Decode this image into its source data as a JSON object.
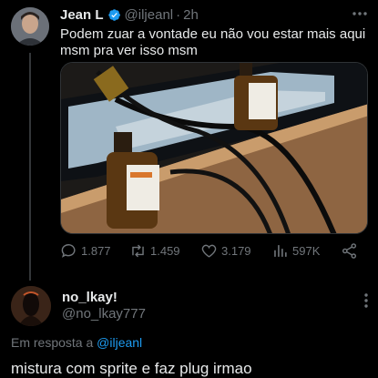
{
  "tweet": {
    "author_name": "Jean L",
    "author_handle": "@iljeanl",
    "separator": "·",
    "time": "2h",
    "text": "Podem zuar a vontade eu não vou estar mais aqui msm pra ver isso msm",
    "stats": {
      "replies": "1.877",
      "retweets": "1.459",
      "likes": "3.179",
      "views": "597K"
    }
  },
  "reply": {
    "author_name": "no_lkay!",
    "author_handle": "@no_lkay777",
    "reply_prefix": "Em resposta a",
    "reply_to": "@iljeanl",
    "text": "mistura com sprite e faz plug irmao"
  },
  "colors": {
    "background": "#000000",
    "text": "#e7e9ea",
    "muted": "#71767b",
    "accent": "#1d9bf0"
  }
}
